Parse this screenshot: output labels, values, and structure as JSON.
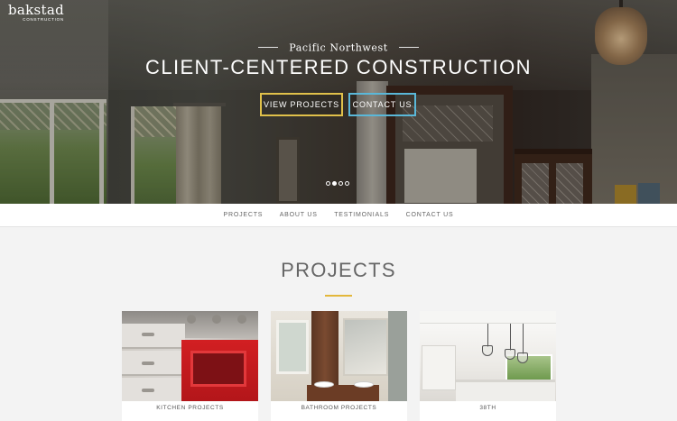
{
  "brand": {
    "name": "bakstad",
    "sub": "CONSTRUCTION"
  },
  "hero": {
    "tagline": "Pacific Northwest",
    "headline": "CLIENT-CENTERED CONSTRUCTION",
    "buttons": {
      "projects": "VIEW PROJECTS",
      "contact": "CONTACT US"
    },
    "slides": {
      "count": 4,
      "active_index": 1
    },
    "colors": {
      "projects_border": "#e0c04a",
      "contact_border": "#5ab8d9"
    }
  },
  "nav": {
    "items": [
      "PROJECTS",
      "ABOUT US",
      "TESTIMONIALS",
      "CONTACT US"
    ]
  },
  "projects": {
    "title": "PROJECTS",
    "accent_color": "#e3b73b",
    "cards": [
      {
        "caption": "KITCHEN PROJECTS"
      },
      {
        "caption": "BATHROOM PROJECTS"
      },
      {
        "caption": "38TH"
      }
    ]
  }
}
